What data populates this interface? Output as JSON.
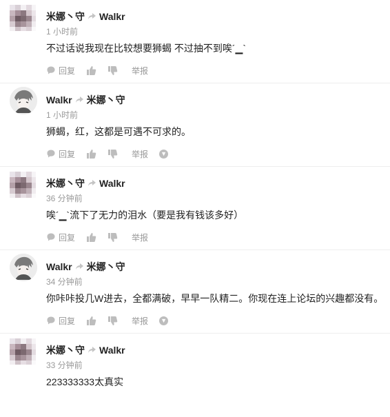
{
  "comments": [
    {
      "author": "米娜丶守",
      "reply_to": "Walkr",
      "time": "1 小时前",
      "text": "不过话说我现在比较想要狮蝎 不过抽不到唉´▁`",
      "reply_label": "回复",
      "report_label": "举报",
      "avatar": "pixelated"
    },
    {
      "author": "Walkr",
      "reply_to": "米娜丶守",
      "time": "1 小时前",
      "text": "狮蝎，红，这都是可遇不可求的。",
      "reply_label": "回复",
      "report_label": "举报",
      "avatar": "anime"
    },
    {
      "author": "米娜丶守",
      "reply_to": "Walkr",
      "time": "36 分钟前",
      "text": "唉´▁`流下了无力的泪水（要是我有钱该多好）",
      "reply_label": "回复",
      "report_label": "举报",
      "avatar": "pixelated"
    },
    {
      "author": "Walkr",
      "reply_to": "米娜丶守",
      "time": "34 分钟前",
      "text": "你咔咔投几W进去，全都满破，早早一队精二。你现在连上论坛的兴趣都没有。",
      "reply_label": "回复",
      "report_label": "举报",
      "avatar": "anime"
    },
    {
      "author": "米娜丶守",
      "reply_to": "Walkr",
      "time": "33 分钟前",
      "text": "223333333太真实",
      "avatar": "pixelated"
    }
  ],
  "icons": {
    "reply": "comment-bubble-icon",
    "like": "thumbs-up-icon",
    "dislike": "thumbs-down-icon",
    "share_arrow": "reply-arrow-icon",
    "more": "chevron-down-icon"
  },
  "colors": {
    "muted": "#999999",
    "icon": "#bdbdbd",
    "name": "#222222"
  }
}
